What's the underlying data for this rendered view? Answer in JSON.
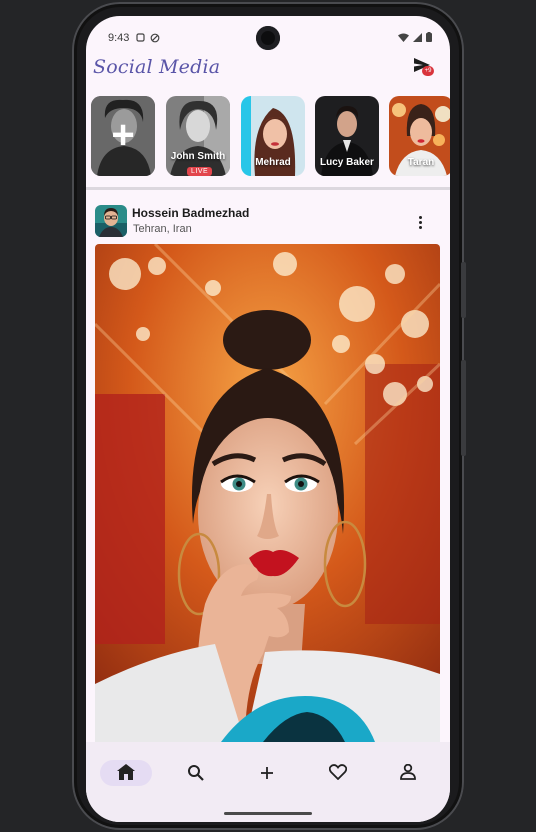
{
  "status_bar": {
    "time": "9:43"
  },
  "app": {
    "title": "Social Media"
  },
  "messages": {
    "badge": "+9"
  },
  "stories": [
    {
      "name": "",
      "type": "add"
    },
    {
      "name": "John Smith",
      "badge": "LIVE"
    },
    {
      "name": "Mehrad"
    },
    {
      "name": "Lucy Baker"
    },
    {
      "name": "Taran"
    }
  ],
  "post": {
    "author": "Hossein Badmezhad",
    "location": "Tehran, Iran"
  },
  "nav": {
    "items": [
      "home",
      "search",
      "add",
      "favorites",
      "profile"
    ],
    "active": "home"
  },
  "colors": {
    "background": "#fcf5fc",
    "accent": "#5a55a8",
    "badge": "#d9343c",
    "nav_active": "#e5dcf3"
  }
}
